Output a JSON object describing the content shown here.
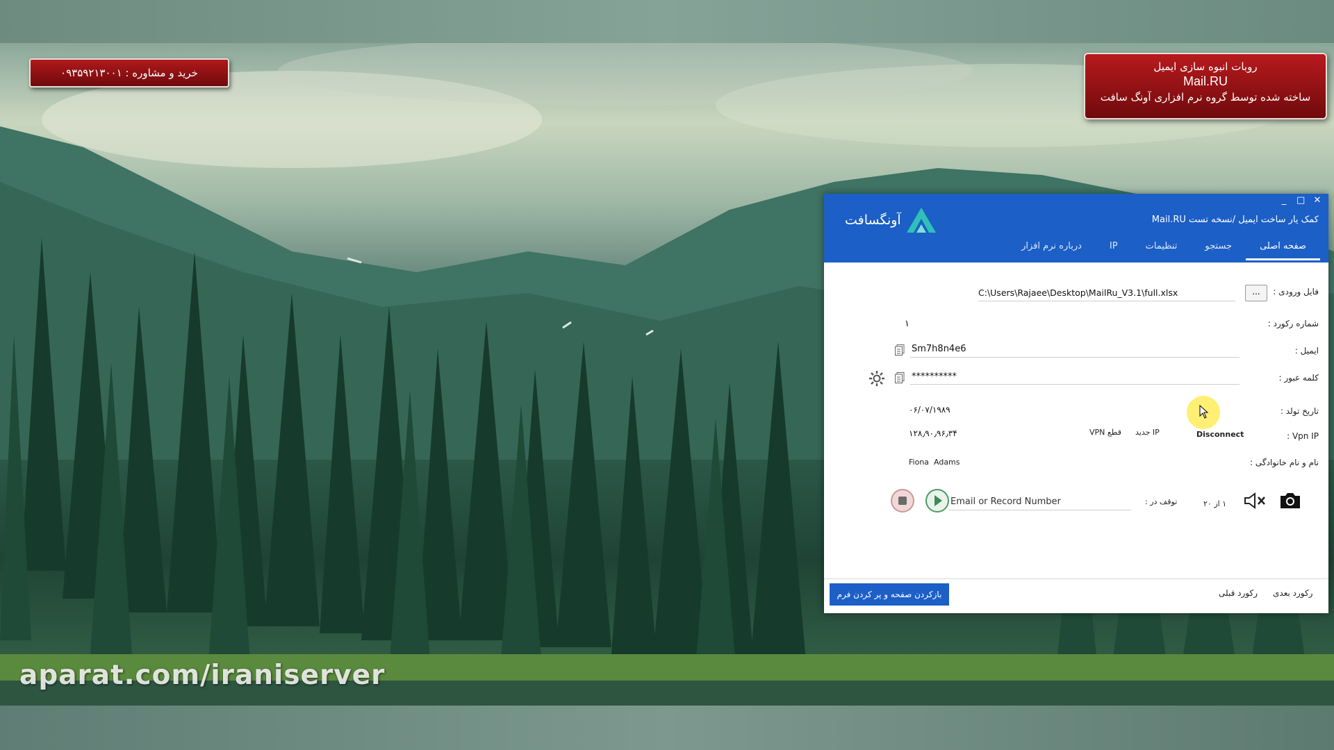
{
  "banners": {
    "left": "خرید و مشاوره : ۰۹۳۵۹۲۱۳۰۰۱",
    "right_line1": "روبات انبوه سازی ایمیل",
    "right_line2": "Mail.RU",
    "right_line3": "ساخته شده توسط گروه نرم افزاری آونگ سافت"
  },
  "watermark": "aparat.com/iraniserver",
  "window": {
    "controls": {
      "minimize": "_",
      "maximize": "□",
      "close": "✕"
    },
    "logo_text": "آونگسافت",
    "title": "کمک یار ساخت ایمیل /نسخه تست  Mail.RU",
    "tabs": [
      {
        "label": "صفحه اصلی",
        "active": true
      },
      {
        "label": "جستجو",
        "active": false
      },
      {
        "label": "تنظیمات",
        "active": false
      },
      {
        "label": "IP",
        "active": false
      },
      {
        "label": "درباره نرم افزار",
        "active": false
      }
    ]
  },
  "form": {
    "input_file_label": "فایل ورودی :",
    "browse_label": "...",
    "input_file_value": "C:\\Users\\Rajaee\\Desktop\\MailRu_V3.1\\full.xlsx",
    "record_label": "شماره رکورد :",
    "record_value": "۱",
    "email_label": "ایمیل :",
    "email_value": "Sm7h8n4e6",
    "password_label": "کلمه عبور :",
    "password_value": "**********",
    "birth_label": "تاریخ تولد :",
    "birth_value": "۰۶/۰۷/۱۹۸۹",
    "vpn_label": "Vpn IP :",
    "vpn_value": "۱۲۸٫۹۰٫۹۶٫۳۴",
    "vpn_cut": "قطع VPN",
    "new_ip": "IP جدید",
    "disconnect": "Disconnect",
    "name_label": "نام و نام خانوادگی :",
    "first_name": "Fiona",
    "last_name": "Adams",
    "stop_at_label": "توقف در :",
    "stop_at_placeholder": "Email or Record Number",
    "counter": "۱ از ۲۰"
  },
  "footer": {
    "reset_button": "بازکردن صفحه و پر کردن فرم",
    "prev_record": "رکورد قبلی",
    "next_record": "رکورد بعدی"
  },
  "colors": {
    "header_blue": "#1c5fc7",
    "banner_red": "#b0191c"
  }
}
